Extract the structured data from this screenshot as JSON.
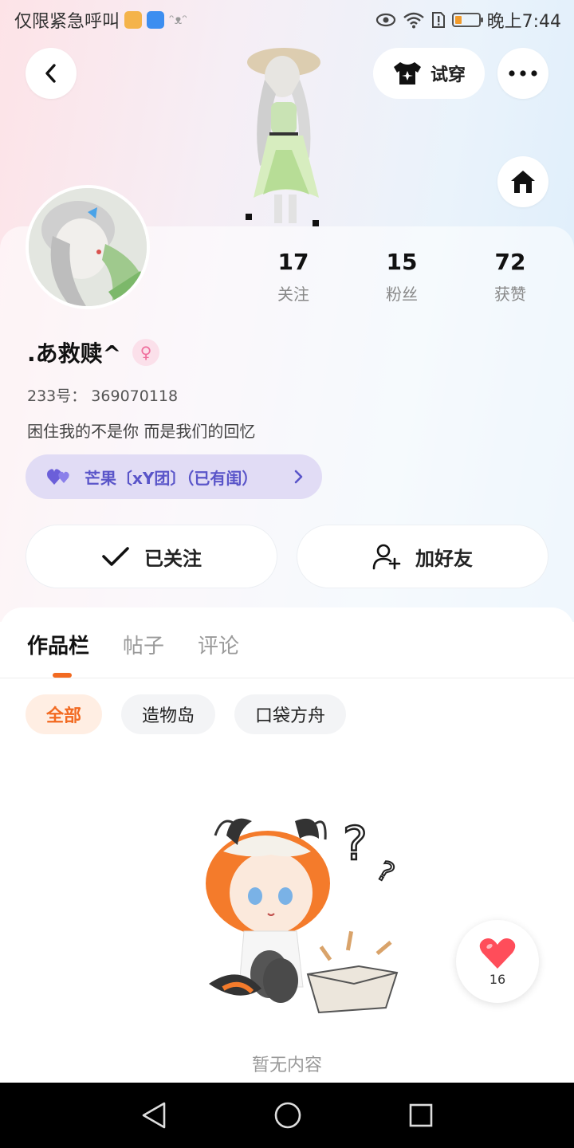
{
  "status_bar": {
    "left_text": "仅限紧急呼叫",
    "time": "晚上7:44"
  },
  "header": {
    "try_on_label": "试穿"
  },
  "profile": {
    "name": ".あ救赎^",
    "gender_symbol": "♀",
    "uid": "233号： 369070118",
    "bio": "困住我的不是你  而是我们的回忆",
    "group": "芒果〔xY团〕（已有闺）",
    "stats": [
      {
        "num": "17",
        "label": "关注"
      },
      {
        "num": "15",
        "label": "粉丝"
      },
      {
        "num": "72",
        "label": "获赞"
      }
    ]
  },
  "actions": {
    "followed_label": "已关注",
    "add_friend_label": "加好友"
  },
  "tabs": [
    "作品栏",
    "帖子",
    "评论"
  ],
  "filters": [
    "全部",
    "造物岛",
    "口袋方舟"
  ],
  "empty_text": "暂无内容",
  "like_count": "16",
  "colors": {
    "accent": "#f26a21",
    "group_purple": "#5a55c9",
    "like_red": "#ff4d5a"
  }
}
